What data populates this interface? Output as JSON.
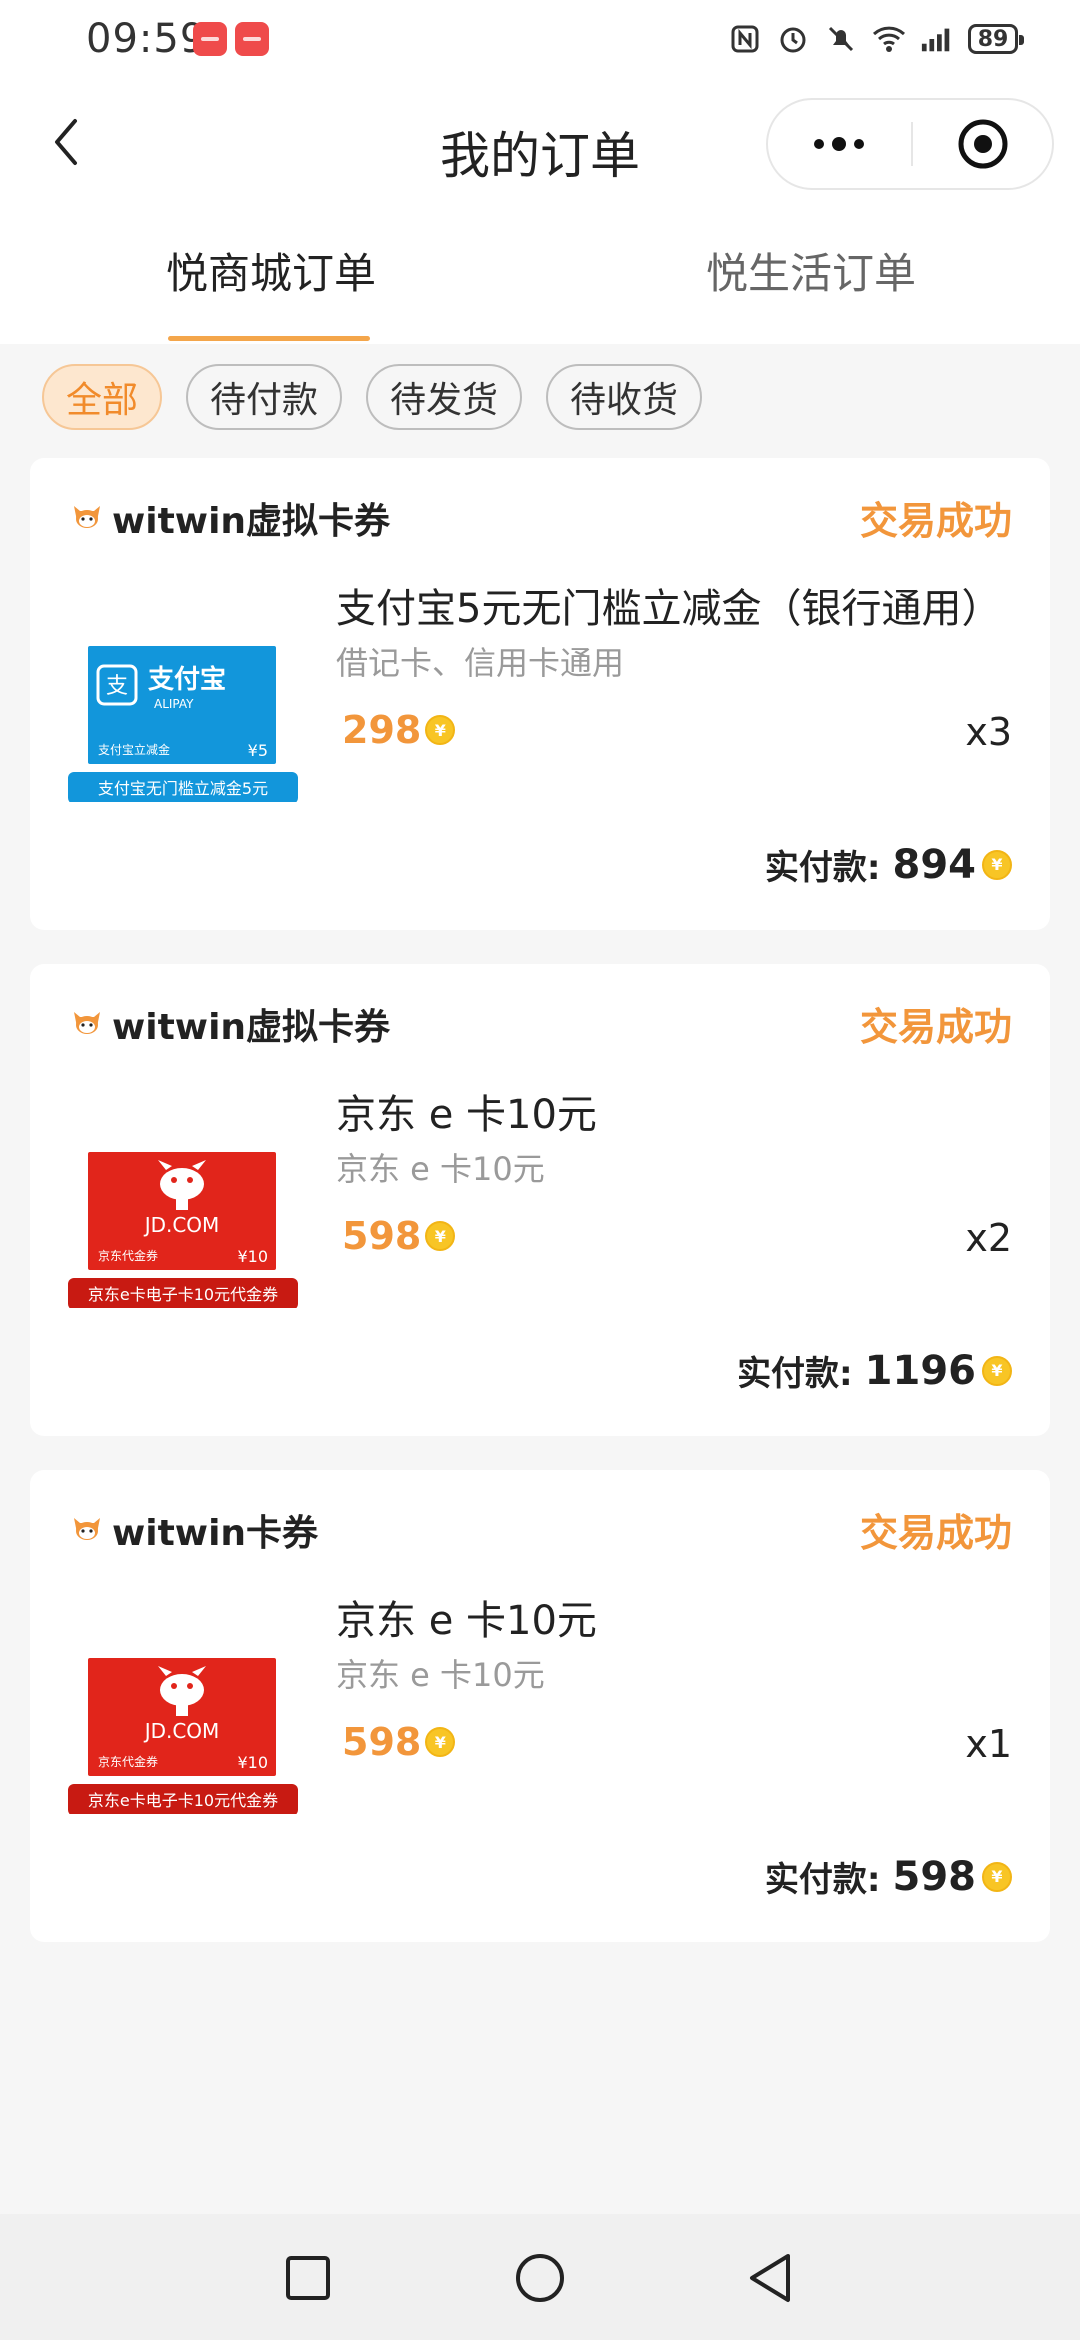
{
  "status_bar": {
    "time": "09:59",
    "battery": "89"
  },
  "header": {
    "title": "我的订单"
  },
  "tabs": [
    {
      "label": "悦商城订单",
      "active": true
    },
    {
      "label": "悦生活订单",
      "active": false
    }
  ],
  "filters": [
    {
      "label": "全部",
      "active": true
    },
    {
      "label": "待付款",
      "active": false
    },
    {
      "label": "待发货",
      "active": false
    },
    {
      "label": "待收货",
      "active": false
    }
  ],
  "orders": [
    {
      "shop": "witwin虚拟卡券",
      "status": "交易成功",
      "image": {
        "type": "alipay",
        "brand": "支付宝",
        "brand_en": "ALIPAY",
        "caption": "支付宝立减金",
        "value": "¥5",
        "ribbon": "支付宝无门槛立减金5元"
      },
      "title": "支付宝5元无门槛立减金（银行通用）",
      "subtitle": "借记卡、信用卡通用",
      "price": "298",
      "qty": "x3",
      "total_label": "实付款:",
      "total": "894"
    },
    {
      "shop": "witwin虚拟卡券",
      "status": "交易成功",
      "image": {
        "type": "jd",
        "brand_en": "JD.COM",
        "caption": "京东代金券",
        "value": "¥10",
        "ribbon": "京东e卡电子卡10元代金券"
      },
      "title": "京东 e 卡10元",
      "subtitle": "京东 e 卡10元",
      "price": "598",
      "qty": "x2",
      "total_label": "实付款:",
      "total": "1196"
    },
    {
      "shop": "witwin卡券",
      "status": "交易成功",
      "image": {
        "type": "jd",
        "brand_en": "JD.COM",
        "caption": "京东代金券",
        "value": "¥10",
        "ribbon": "京东e卡电子卡10元代金券"
      },
      "title": "京东 e 卡10元",
      "subtitle": "京东 e 卡10元",
      "price": "598",
      "qty": "x1",
      "total_label": "实付款:",
      "total": "598"
    }
  ],
  "colors": {
    "accent": "#f2963b",
    "alipay_blue": "#1296db",
    "jd_red": "#e1251b"
  },
  "icons": [
    "back-arrow-icon",
    "more-dots-icon",
    "close-circle-icon",
    "shop-mascot-icon",
    "coin-icon",
    "nav-recents-icon",
    "nav-home-icon",
    "nav-back-icon"
  ]
}
